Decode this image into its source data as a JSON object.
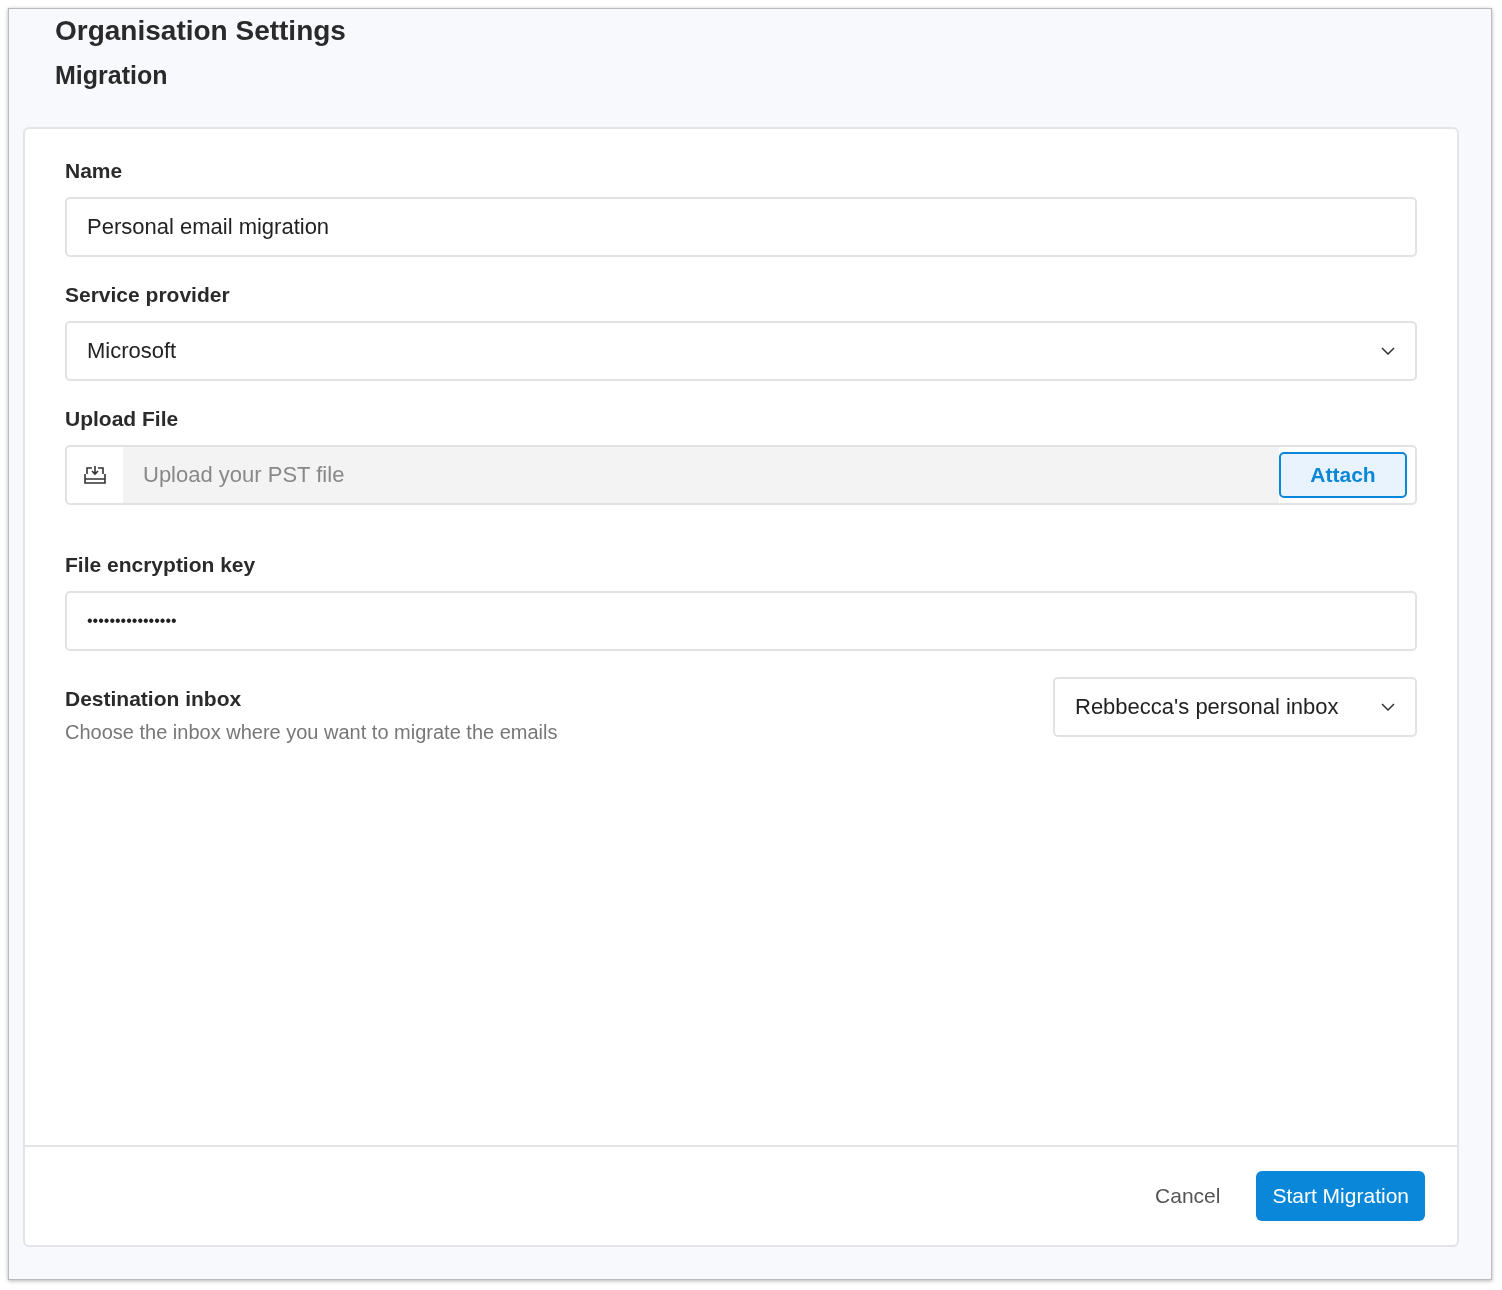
{
  "header": {
    "title": "Organisation Settings",
    "subtitle": "Migration"
  },
  "form": {
    "name": {
      "label": "Name",
      "value": "Personal email migration"
    },
    "service_provider": {
      "label": "Service provider",
      "value": "Microsoft"
    },
    "upload_file": {
      "label": "Upload File",
      "placeholder": "Upload your PST file",
      "button": "Attach"
    },
    "encryption_key": {
      "label": "File encryption key",
      "value": "••••••••••••••••"
    },
    "destination_inbox": {
      "label": "Destination inbox",
      "description": "Choose the inbox where you want to migrate the emails",
      "value": "Rebbecca's personal inbox"
    }
  },
  "footer": {
    "buttons": [
      {
        "label": "Cancel",
        "kind": "secondary"
      },
      {
        "label": "Start Migration",
        "kind": "primary"
      }
    ]
  }
}
